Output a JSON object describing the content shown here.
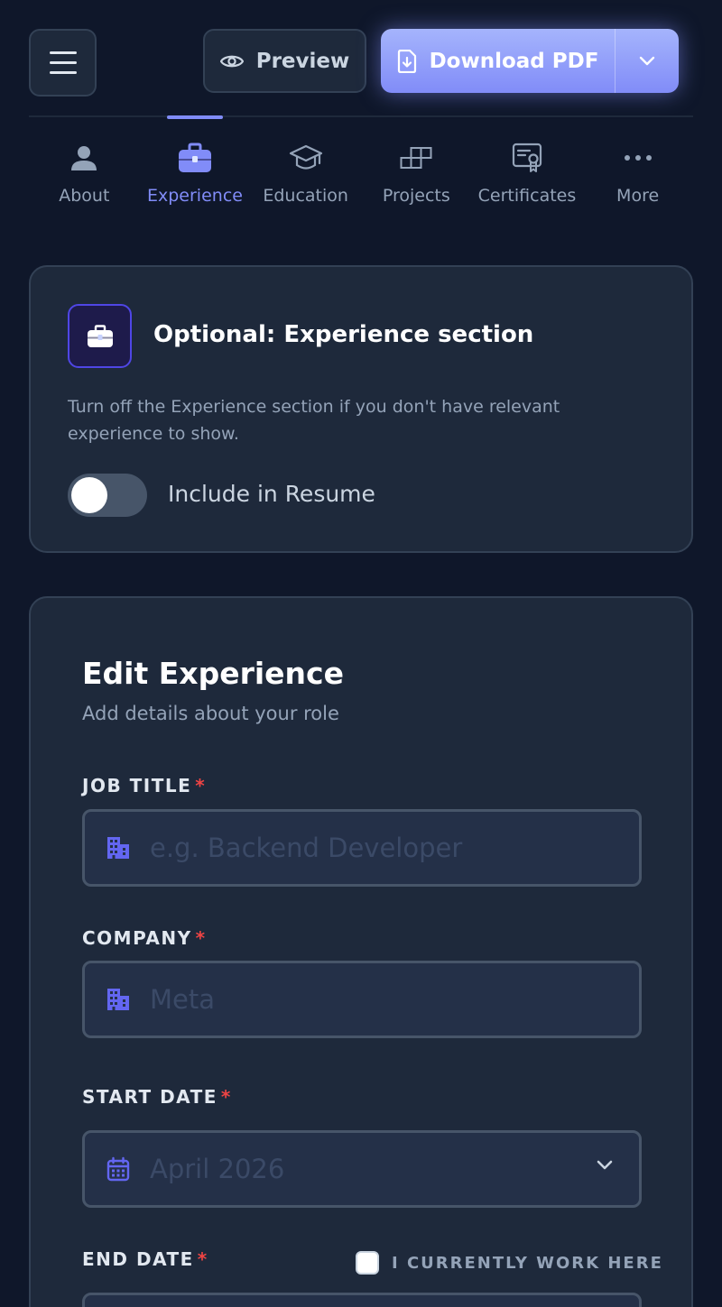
{
  "topbar": {
    "menu_icon": "hamburger-icon",
    "preview_label": "Preview",
    "preview_icon": "eye-icon",
    "download_label": "Download PDF",
    "download_icon": "file-download-icon",
    "download_caret_icon": "chevron-down-icon",
    "accent_color": "#818cf8"
  },
  "tabs": [
    {
      "label": "About",
      "icon": "user-icon",
      "active": false
    },
    {
      "label": "Experience",
      "icon": "briefcase-icon",
      "active": true
    },
    {
      "label": "Education",
      "icon": "graduation-cap-icon",
      "active": false
    },
    {
      "label": "Projects",
      "icon": "blocks-icon",
      "active": false
    },
    {
      "label": "Certificates",
      "icon": "certificate-icon",
      "active": false
    },
    {
      "label": "More",
      "icon": "more-dots-icon",
      "active": false
    }
  ],
  "optional_section": {
    "icon": "briefcase-icon",
    "title": "Optional: Experience section",
    "description": "Turn off the Experience section if you don't have relevant experience to show.",
    "toggle_label": "Include in Resume",
    "toggle_on": false
  },
  "edit_form": {
    "title": "Edit Experience",
    "subtitle": "Add details about your role",
    "required_mark": "*",
    "job_title": {
      "label": "JOB TITLE",
      "placeholder": "e.g. Backend Developer",
      "icon": "building-icon"
    },
    "company": {
      "label": "COMPANY",
      "placeholder": "Meta",
      "icon": "building-icon"
    },
    "start_date": {
      "label": "START DATE",
      "value": "April 2026",
      "icon": "calendar-icon"
    },
    "end_date": {
      "label": "END DATE"
    },
    "currently_work": {
      "label": "I CURRENTLY WORK HERE",
      "checked": false
    }
  },
  "colors": {
    "background": "#0f172a",
    "card": "#1e293b",
    "required": "#ef4444"
  }
}
